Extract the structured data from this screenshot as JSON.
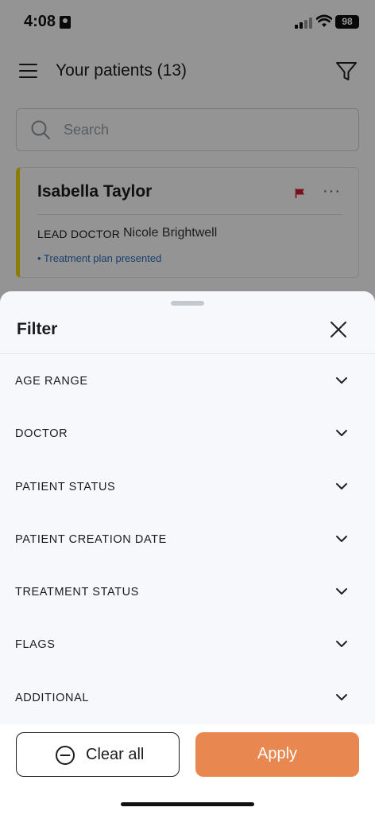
{
  "status_bar": {
    "time": "4:08",
    "battery": "98"
  },
  "header": {
    "title": "Your patients (13)"
  },
  "search": {
    "placeholder": "Search"
  },
  "patient_card": {
    "name": "Isabella Taylor",
    "lead_label": "LEAD DOCTOR",
    "lead_doctor": "Nicole Brightwell",
    "status": "• Treatment plan presented",
    "accent_color": "#f2d60a",
    "flag_color": "#d0202a"
  },
  "filter_sheet": {
    "title": "Filter",
    "filters": [
      "AGE RANGE",
      "DOCTOR",
      "PATIENT STATUS",
      "PATIENT CREATION DATE",
      "TREATMENT STATUS",
      "FLAGS",
      "ADDITIONAL"
    ],
    "clear_label": "Clear all",
    "apply_label": "Apply",
    "apply_color": "#e8874f"
  }
}
